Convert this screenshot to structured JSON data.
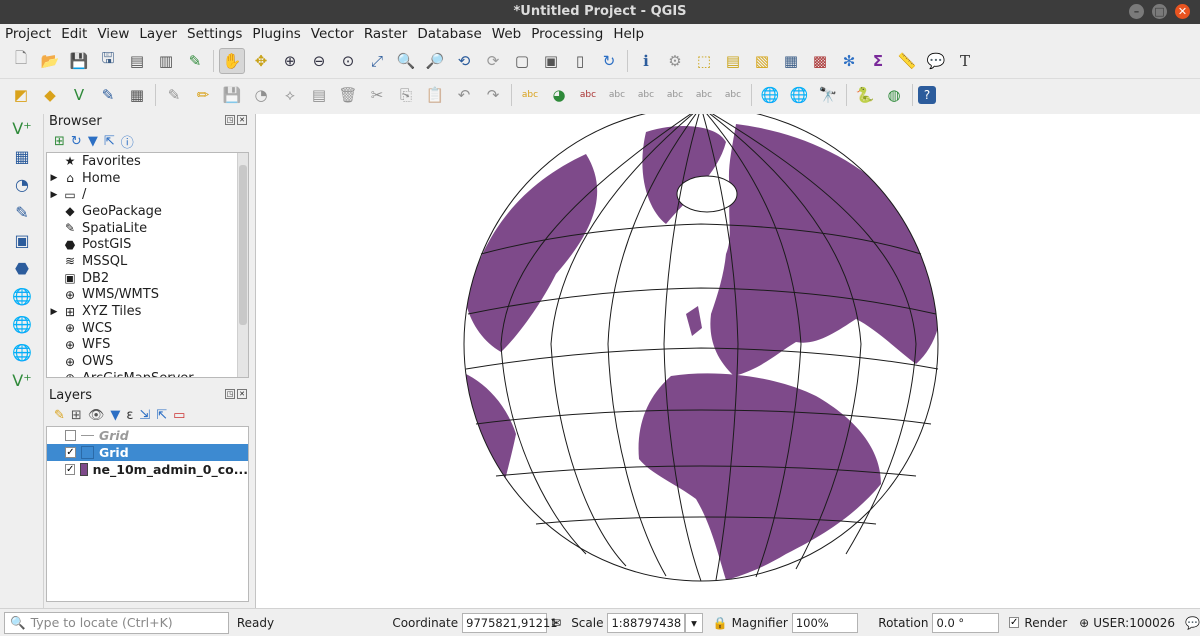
{
  "window": {
    "title": "*Untitled Project - QGIS",
    "min": "–",
    "max": "□",
    "close": "✕"
  },
  "menu": [
    "Project",
    "Edit",
    "View",
    "Layer",
    "Settings",
    "Plugins",
    "Vector",
    "Raster",
    "Database",
    "Web",
    "Processing",
    "Help"
  ],
  "browser": {
    "title": "Browser",
    "items": [
      {
        "arrow": "",
        "icon": "★",
        "label": "Favorites"
      },
      {
        "arrow": "▶",
        "icon": "⌂",
        "label": "Home"
      },
      {
        "arrow": "▶",
        "icon": "▭",
        "label": "/"
      },
      {
        "arrow": "",
        "icon": "◆",
        "label": "GeoPackage"
      },
      {
        "arrow": "",
        "icon": "✎",
        "label": "SpatiaLite"
      },
      {
        "arrow": "",
        "icon": "⬣",
        "label": "PostGIS"
      },
      {
        "arrow": "",
        "icon": "≋",
        "label": "MSSQL"
      },
      {
        "arrow": "",
        "icon": "▣",
        "label": "DB2"
      },
      {
        "arrow": "",
        "icon": "⊕",
        "label": "WMS/WMTS"
      },
      {
        "arrow": "▶",
        "icon": "⊞",
        "label": "XYZ Tiles"
      },
      {
        "arrow": "",
        "icon": "⊕",
        "label": "WCS"
      },
      {
        "arrow": "",
        "icon": "⊕",
        "label": "WFS"
      },
      {
        "arrow": "",
        "icon": "⊕",
        "label": "OWS"
      },
      {
        "arrow": "",
        "icon": "⊕",
        "label": "ArcGisMapServer"
      }
    ]
  },
  "layers": {
    "title": "Layers",
    "items": [
      {
        "name": "Grid",
        "checked": "",
        "state": "disabled"
      },
      {
        "name": "Grid",
        "checked": "✓",
        "state": "selected"
      },
      {
        "name": "ne_10m_admin_0_co...",
        "checked": "✓",
        "state": "normal",
        "color": "#7e4a8a"
      }
    ]
  },
  "status": {
    "locate_placeholder": "Type to locate (Ctrl+K)",
    "ready": "Ready",
    "coordinate_label": "Coordinate",
    "coordinate_value": "9775821,91211",
    "scale_label": "Scale",
    "scale_value": "1:88797438",
    "magnifier_label": "Magnifier",
    "magnifier_value": "100%",
    "rotation_label": "Rotation",
    "rotation_value": "0.0 °",
    "render_label": "Render",
    "render_checked": "✓",
    "crs": "USER:100026"
  },
  "colors": {
    "land": "#7e4a8a",
    "selection": "#3d8ad1"
  }
}
